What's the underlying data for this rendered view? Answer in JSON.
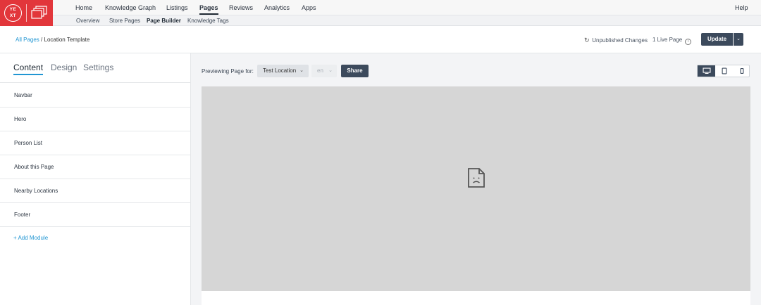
{
  "logo": {
    "text": "YEXT"
  },
  "nav": {
    "items": [
      {
        "label": "Home"
      },
      {
        "label": "Knowledge Graph"
      },
      {
        "label": "Listings"
      },
      {
        "label": "Pages",
        "active": true
      },
      {
        "label": "Reviews"
      },
      {
        "label": "Analytics"
      },
      {
        "label": "Apps"
      }
    ],
    "help": "Help"
  },
  "subnav": {
    "items": [
      {
        "label": "Overview"
      },
      {
        "label": "Store Pages"
      },
      {
        "label": "Page Builder",
        "active": true
      },
      {
        "label": "Knowledge Tags"
      }
    ]
  },
  "header": {
    "breadcrumb_link": "All Pages",
    "breadcrumb_sep": "/",
    "breadcrumb_current": "Location Template",
    "status": "Unpublished Changes",
    "live_pages": "1 Live Page",
    "update_label": "Update"
  },
  "sidebar": {
    "tabs": [
      {
        "label": "Content",
        "active": true
      },
      {
        "label": "Design"
      },
      {
        "label": "Settings"
      }
    ],
    "modules": [
      {
        "label": "Navbar"
      },
      {
        "label": "Hero"
      },
      {
        "label": "Person List"
      },
      {
        "label": "About this Page"
      },
      {
        "label": "Nearby Locations"
      },
      {
        "label": "Footer"
      }
    ],
    "add_module": "+ Add Module"
  },
  "preview": {
    "label": "Previewing Page for:",
    "location": "Test Location",
    "language": "en",
    "share_label": "Share",
    "device_selected": "desktop"
  },
  "colors": {
    "brand": "#e2363b",
    "accent": "#2196d3",
    "button": "#3c4a5c"
  }
}
